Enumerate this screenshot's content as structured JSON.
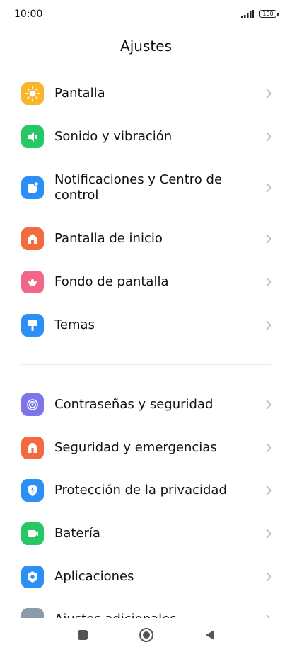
{
  "status_bar": {
    "time": "10:00",
    "battery": "100"
  },
  "header": {
    "title": "Ajustes"
  },
  "items": [
    {
      "label": "Pantalla",
      "color": "#F9B52B",
      "icon": "brightness-icon"
    },
    {
      "label": "Sonido y vibración",
      "color": "#26C866",
      "icon": "speaker-icon"
    },
    {
      "label": "Notificaciones y Centro de control",
      "color": "#2B8FF5",
      "icon": "notification-icon"
    },
    {
      "label": "Pantalla de inicio",
      "color": "#F26A3D",
      "icon": "home-icon"
    },
    {
      "label": "Fondo de pantalla",
      "color": "#F2668B",
      "icon": "flower-icon"
    },
    {
      "label": "Temas",
      "color": "#2B8FF5",
      "icon": "paint-roller-icon"
    },
    {
      "label": "Contraseñas y seguridad",
      "color": "#7E75E8",
      "icon": "fingerprint-icon"
    },
    {
      "label": "Seguridad y emergencias",
      "color": "#F26A3D",
      "icon": "alarm-icon"
    },
    {
      "label": "Protección de la privacidad",
      "color": "#2B8FF5",
      "icon": "shield-icon"
    },
    {
      "label": "Batería",
      "color": "#26C866",
      "icon": "battery-icon"
    },
    {
      "label": "Aplicaciones",
      "color": "#2B8FF5",
      "icon": "gear-icon"
    },
    {
      "label": "Ajustes adicionales",
      "color": "#8A9AA8",
      "icon": "more-icon"
    }
  ]
}
